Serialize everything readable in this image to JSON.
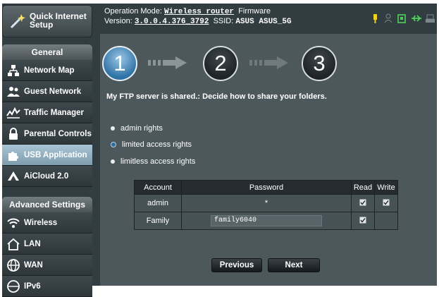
{
  "sidebar": {
    "quick_setup": "Quick Internet Setup",
    "general_header": "General",
    "general_items": [
      {
        "label": "Network Map",
        "icon": "network-map-icon"
      },
      {
        "label": "Guest Network",
        "icon": "guest-network-icon"
      },
      {
        "label": "Traffic Manager",
        "icon": "traffic-manager-icon"
      },
      {
        "label": "Parental Controls",
        "icon": "parental-controls-icon"
      },
      {
        "label": "USB Application",
        "icon": "usb-application-icon",
        "active": true
      },
      {
        "label": "AiCloud 2.0",
        "icon": "aicloud-icon"
      }
    ],
    "advanced_header": "Advanced Settings",
    "advanced_items": [
      {
        "label": "Wireless",
        "icon": "wireless-icon"
      },
      {
        "label": "LAN",
        "icon": "lan-icon"
      },
      {
        "label": "WAN",
        "icon": "wan-icon"
      },
      {
        "label": "IPv6",
        "icon": "ipv6-icon"
      }
    ]
  },
  "header": {
    "op_mode_label": "Operation Mode:",
    "op_mode_value": "Wireless router",
    "firmware_label": "Firmware",
    "version_label": "Version:",
    "version_value": "3.0.0.4.376_3792",
    "ssid_label": "SSID:",
    "ssid_value": "ASUS  ASUS_5G",
    "status_icons": [
      "usb-status-icon",
      "user-status-icon",
      "storage-status-icon",
      "usb-plug-icon",
      "printer-icon"
    ]
  },
  "wizard": {
    "steps": [
      "1",
      "2",
      "3"
    ],
    "current_step": 1,
    "description": "My FTP server is shared.: Decide how to share your folders.",
    "options": [
      {
        "label": "admin rights",
        "selected": false
      },
      {
        "label": "limited access rights",
        "selected": true
      },
      {
        "label": "limitless access rights",
        "selected": false
      }
    ],
    "table": {
      "headers": {
        "account": "Account",
        "password": "Password",
        "read": "Read",
        "write": "Write"
      },
      "rows": [
        {
          "account": "admin",
          "password": "*",
          "read": true,
          "write": true
        },
        {
          "account": "Family",
          "password": "family6040",
          "read": true,
          "write": false
        }
      ]
    },
    "prev_label": "Previous",
    "next_label": "Next"
  },
  "colors": {
    "background": "#323d42",
    "panel": "#4d585d",
    "active_item": "#8fb0c3",
    "step_active": "#2f73a6",
    "status_yellow": "#f1d21c",
    "status_green": "#4fd05a"
  }
}
